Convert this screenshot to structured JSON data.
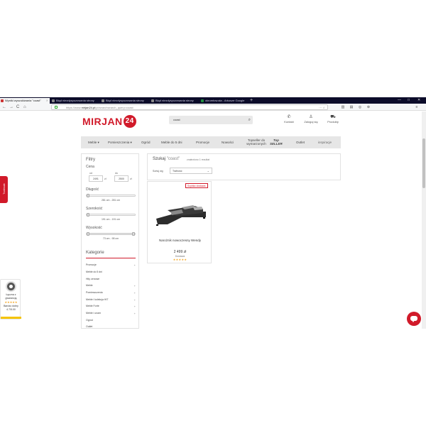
{
  "browser": {
    "tabs": [
      {
        "title": "Wyniki wyszukiwania \"coast\"",
        "active": true
      },
      {
        "title": "Błąd niezdyspozowania strony",
        "active": false
      },
      {
        "title": "Błąd niezdyspozowania strony",
        "active": false
      },
      {
        "title": "Błąd niezdyspozowania strony",
        "active": false
      },
      {
        "title": "okrumtow.ala - Arkusze Google",
        "active": false
      }
    ],
    "new_tab": "+",
    "url_host": "mirjan24.pl",
    "url_prefix": "https://www.",
    "url_path": "/pl/searchsearch_query=coast",
    "url_more": "··· ☆",
    "back": "←",
    "forward": "→",
    "reload": "C",
    "home": "⌂",
    "win_min": "—",
    "win_max": "□",
    "win_close": "✕"
  },
  "header": {
    "logo_text": "MIRJAN",
    "logo_badge": "24",
    "search_value": "coast",
    "actions": [
      {
        "icon": "phone-icon",
        "glyph": "✆",
        "label": "Kontakt"
      },
      {
        "icon": "user-icon",
        "glyph": "♙",
        "label": "Zaloguj się"
      },
      {
        "icon": "cart-icon",
        "glyph": "⛟",
        "label": "Produkty"
      }
    ]
  },
  "nav": {
    "meble": "Meble ▾",
    "pomieszczenia": "Pomieszczenia ▾",
    "ogrod": "Ogród",
    "meble5": "Meble do 5 dni",
    "promocje": "Promocje",
    "nowosci": "Nowości",
    "topseller_line1": "Topseller do",
    "topseller_line2": "wymarzonych",
    "top_tag": "Top",
    "top_tag2": "SELLER",
    "outlet": "Outlet",
    "inspiracje": "inspiracje"
  },
  "filters": {
    "title": "Filtry",
    "price_label": "Cena",
    "price_from_label": "od",
    "price_to_label": "do",
    "price_from": "2491",
    "price_to": "2500",
    "currency": "zł",
    "length_label": "Długość",
    "length_range": "281 cm - 281 cm",
    "width_label": "Szerokość",
    "width_range": "191 cm - 191 cm",
    "height_label": "Wysokość",
    "height_range": "73 cm - 98 cm"
  },
  "categories": {
    "title": "Kategorie",
    "items": [
      {
        "label": "Promocje",
        "plus": "+"
      },
      {
        "label": "Meble do 5 dni",
        "plus": ""
      },
      {
        "label": "Hity cenowe",
        "plus": ""
      },
      {
        "label": "Meble",
        "plus": "+"
      },
      {
        "label": "Pomieszczenia",
        "plus": "+"
      },
      {
        "label": "Meble i kolekcja HIT",
        "plus": "+"
      },
      {
        "label": "Meble Forte",
        "plus": "+"
      },
      {
        "label": "Meble i unam",
        "plus": "+"
      },
      {
        "label": "Ogród",
        "plus": ""
      },
      {
        "label": "Outlet",
        "plus": ""
      }
    ]
  },
  "results": {
    "title_prefix": "Szukaj",
    "query": "\"coast\"",
    "count_text": "znaleziono 1 rezultat",
    "sort_label": "Sortuj wg",
    "sort_value": "Trafność",
    "sort_chevron": "⌄"
  },
  "product": {
    "badge": "Szybka dostawa",
    "name": "Narożnik nowoczesny Wendy",
    "price": "2 499 zł",
    "status": "Dostawa",
    "stars": "★★★★★"
  },
  "side_tab": "Trustmate",
  "trust": {
    "line1": "Łączna z",
    "line2": "gwarancją",
    "stars": "★★★★★",
    "line3": "Bardzo dobry",
    "line4": "4.7/5.00"
  },
  "colors": {
    "brand": "#d11a2a",
    "nav_bg": "#e6e6e6",
    "stars": "#f5a623"
  }
}
